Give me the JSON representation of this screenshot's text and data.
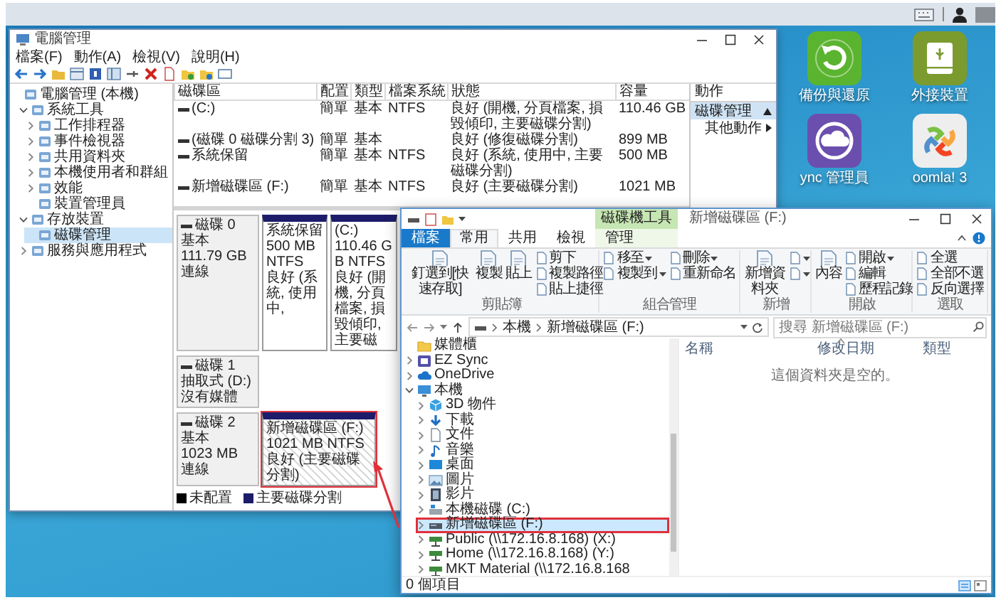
{
  "disk_management": {
    "title": "電腦管理",
    "menu": [
      "檔案(F)",
      "動作(A)",
      "檢視(V)",
      "說明(H)"
    ],
    "tree": [
      {
        "label": "電腦管理 (本機)",
        "selected": false,
        "children": [
          {
            "label": "系統工具",
            "selected": false,
            "expanded": true,
            "children": [
              {
                "label": "工作排程器",
                "selected": false,
                "expanded": false
              },
              {
                "label": "事件檢視器",
                "selected": false,
                "expanded": false
              },
              {
                "label": "共用資料夾",
                "selected": false,
                "expanded": false
              },
              {
                "label": "本機使用者和群組",
                "selected": false,
                "expanded": false
              },
              {
                "label": "效能",
                "selected": false,
                "expanded": false
              },
              {
                "label": "裝置管理員",
                "selected": false
              }
            ]
          },
          {
            "label": "存放裝置",
            "selected": false,
            "expanded": true,
            "children": [
              {
                "label": "磁碟管理",
                "selected": true
              }
            ]
          },
          {
            "label": "服務與應用程式",
            "selected": false,
            "expanded": false
          }
        ]
      }
    ],
    "table": {
      "columns": [
        "磁碟區",
        "配置",
        "類型",
        "檔案系統",
        "狀態",
        "容量"
      ],
      "rows": [
        {
          "volume": "(C:)",
          "layout": "簡單",
          "type": "基本",
          "file_system": "NTFS",
          "status": "良好 (開機, 分頁檔案, 損毀傾印, 主要磁碟分割)",
          "capacity": "110.46 GB"
        },
        {
          "volume": "(磁碟 0 磁碟分割 3)",
          "layout": "簡單",
          "type": "基本",
          "status": "良好 (修復磁碟分割)",
          "capacity": "899 MB"
        },
        {
          "volume": "系統保留",
          "layout": "簡單",
          "type": "基本",
          "file_system": "NTFS",
          "status": "良好 (系統, 使用中, 主要磁碟分割)",
          "capacity": "500 MB"
        },
        {
          "volume": "新增磁碟區 (F:)",
          "layout": "簡單",
          "type": "基本",
          "file_system": "NTFS",
          "status": "良好 (主要磁碟分割)",
          "capacity": "1021 MB"
        }
      ]
    },
    "actions": {
      "title": "動作",
      "items": [
        {
          "label": "磁碟管理",
          "kind": "section"
        },
        {
          "label": "其他動作",
          "kind": "submenu"
        }
      ]
    },
    "disks": [
      {
        "name": "磁碟 0",
        "type": "基本",
        "size": "111.79 GB",
        "status": "連線",
        "partitions": [
          {
            "name": "系統保留",
            "size": "500 MB NTFS",
            "status": "良好 (系統, 使用中,",
            "selected": false,
            "highlighted": false
          },
          {
            "name": "(C:)",
            "size": "110.46 GB NTFS",
            "status": "良好 (開機, 分頁檔案, 損毀傾印, 主要磁",
            "selected": false,
            "highlighted": false
          }
        ]
      },
      {
        "name": "磁碟 1",
        "type": "抽取式 (D:)",
        "status": "沒有媒體"
      },
      {
        "name": "磁碟 2",
        "type": "基本",
        "size": "1023 MB",
        "status": "連線",
        "partitions": [
          {
            "name": "新增磁碟區 (F:)",
            "size": "1021 MB NTFS",
            "status": "良好 (主要磁碟分割)",
            "selected": true,
            "highlighted": true
          }
        ]
      }
    ],
    "legend": [
      {
        "label": "未配置",
        "color": "#000000"
      },
      {
        "label": "主要磁碟分割",
        "color": "#1c1c6b"
      }
    ]
  },
  "explorer": {
    "context_label": "磁碟機工具",
    "title": "新增磁碟區 (F:)",
    "tabs": [
      {
        "label": "檔案",
        "kind": "file",
        "selected": false
      },
      {
        "label": "常用",
        "kind": "tab",
        "selected": true
      },
      {
        "label": "共用",
        "kind": "tab",
        "selected": false
      },
      {
        "label": "檢視",
        "kind": "tab",
        "selected": false
      },
      {
        "label": "管理",
        "kind": "context",
        "selected": false
      }
    ],
    "ribbon": [
      {
        "label": "剪貼簿",
        "columns": [
          [
            {
              "label": "釘選到[快速存取]",
              "kind": "large",
              "dropdown": false
            }
          ],
          [
            {
              "label": "複製",
              "kind": "large",
              "dropdown": false
            }
          ],
          [
            {
              "label": "貼上",
              "kind": "large",
              "dropdown": false
            }
          ],
          [
            {
              "label": "剪下",
              "kind": "small",
              "dropdown": false
            },
            {
              "label": "複製路徑",
              "kind": "small",
              "dropdown": false
            },
            {
              "label": "貼上捷徑",
              "kind": "small",
              "dropdown": false
            }
          ]
        ]
      },
      {
        "label": "組合管理",
        "columns": [
          [
            {
              "label": "移至",
              "kind": "small",
              "dropdown": true
            },
            {
              "label": "複製到",
              "kind": "small",
              "dropdown": true
            }
          ],
          [
            {
              "label": "刪除",
              "kind": "small",
              "dropdown": true
            },
            {
              "label": "重新命名",
              "kind": "small",
              "dropdown": false
            }
          ]
        ]
      },
      {
        "label": "新增",
        "columns": [
          [
            {
              "label": "新增資料夾",
              "kind": "large",
              "dropdown": false
            }
          ],
          [
            {
              "kind": "icon",
              "dropdown": true
            },
            {
              "kind": "icon",
              "dropdown": true
            }
          ]
        ]
      },
      {
        "label": "開啟",
        "columns": [
          [
            {
              "label": "內容",
              "kind": "large",
              "dropdown": false
            }
          ],
          [
            {
              "label": "開啟",
              "kind": "small",
              "dropdown": true
            },
            {
              "label": "編輯",
              "kind": "small",
              "dropdown": false
            },
            {
              "label": "歷程記錄",
              "kind": "small",
              "dropdown": false
            }
          ]
        ]
      },
      {
        "label": "選取",
        "columns": [
          [
            {
              "label": "全選",
              "kind": "small",
              "dropdown": false
            },
            {
              "label": "全部不選",
              "kind": "small",
              "dropdown": false
            },
            {
              "label": "反向選擇",
              "kind": "small",
              "dropdown": false
            }
          ]
        ]
      }
    ],
    "address": {
      "path": [
        "本機",
        "新增磁碟區 (F:)"
      ],
      "search_placeholder": "搜尋 新增磁碟區 (F:)"
    },
    "nav": [
      {
        "label": "媒體櫃",
        "kind": "folder",
        "selected": false,
        "highlighted": false
      },
      {
        "label": "EZ Sync",
        "kind": "app",
        "selected": false,
        "highlighted": false,
        "expanded": false
      },
      {
        "label": "OneDrive",
        "kind": "cloud",
        "selected": false,
        "highlighted": false,
        "expanded": false
      },
      {
        "label": "本機",
        "kind": "computer",
        "selected": false,
        "highlighted": false,
        "expanded": true,
        "children": [
          {
            "label": "3D 物件",
            "kind": "cube",
            "selected": false,
            "highlighted": false,
            "expanded": false
          },
          {
            "label": "下載",
            "kind": "download",
            "selected": false,
            "highlighted": false,
            "expanded": false
          },
          {
            "label": "文件",
            "kind": "document",
            "selected": false,
            "highlighted": false,
            "expanded": false
          },
          {
            "label": "音樂",
            "kind": "music",
            "selected": false,
            "highlighted": false,
            "expanded": false
          },
          {
            "label": "桌面",
            "kind": "desktop",
            "selected": false,
            "highlighted": false,
            "expanded": false
          },
          {
            "label": "圖片",
            "kind": "pictures",
            "selected": false,
            "highlighted": false,
            "expanded": false
          },
          {
            "label": "影片",
            "kind": "videos",
            "selected": false,
            "highlighted": false,
            "expanded": false
          },
          {
            "label": "本機磁碟 (C:)",
            "kind": "drive",
            "selected": false,
            "highlighted": false,
            "expanded": false
          },
          {
            "label": "新增磁碟區 (F:)",
            "kind": "usb-drive",
            "selected": true,
            "highlighted": true,
            "expanded": false
          },
          {
            "label": "Public (\\\\172.16.8.168) (X:)",
            "kind": "network-drive",
            "selected": false,
            "highlighted": false,
            "expanded": false
          },
          {
            "label": "Home (\\\\172.16.8.168) (Y:)",
            "kind": "network-drive",
            "selected": false,
            "highlighted": false,
            "expanded": false
          },
          {
            "label": "MKT Material (\\\\172.16.8.168",
            "kind": "network-drive",
            "selected": false,
            "highlighted": false,
            "expanded": false
          }
        ]
      }
    ],
    "columns": [
      "名稱",
      "修改日期",
      "類型"
    ],
    "empty_message": "這個資料夾是空的。",
    "status": "0 個項目"
  },
  "desktop_icons": [
    {
      "label": "備份與還原",
      "kind": "backup"
    },
    {
      "label": "外接裝置",
      "kind": "drive"
    },
    {
      "label": "ync 管理員",
      "kind": "sync"
    },
    {
      "label": "oomla! 3",
      "kind": "joomla"
    }
  ]
}
